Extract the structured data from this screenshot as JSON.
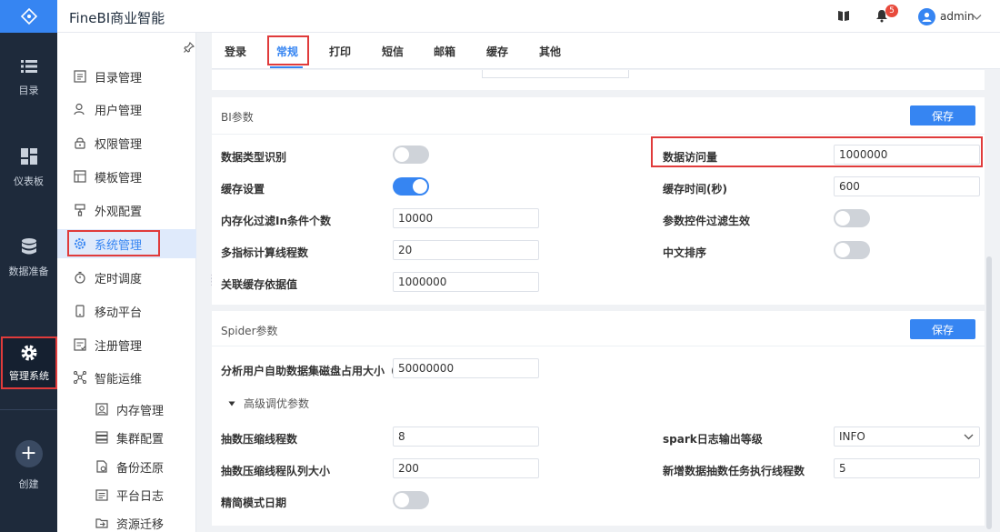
{
  "app": {
    "title": "FineBI商业智能"
  },
  "rail": {
    "items": [
      {
        "label": "目录",
        "icon": "list-icon"
      },
      {
        "label": "仪表板",
        "icon": "dashboard-icon"
      },
      {
        "label": "数据准备",
        "icon": "database-icon"
      },
      {
        "label": "管理系统",
        "icon": "gear-icon",
        "active": true
      },
      {
        "label": "创建",
        "icon": "plus-icon"
      }
    ]
  },
  "header": {
    "notification_count": "5",
    "user": "admin"
  },
  "sidebar": {
    "items": [
      {
        "label": "目录管理"
      },
      {
        "label": "用户管理"
      },
      {
        "label": "权限管理"
      },
      {
        "label": "模板管理"
      },
      {
        "label": "外观配置"
      },
      {
        "label": "系统管理",
        "active": true
      },
      {
        "label": "定时调度"
      },
      {
        "label": "移动平台"
      },
      {
        "label": "注册管理"
      },
      {
        "label": "智能运维"
      },
      {
        "label": "内存管理"
      },
      {
        "label": "集群配置"
      },
      {
        "label": "备份还原"
      },
      {
        "label": "平台日志"
      },
      {
        "label": "资源迁移"
      }
    ]
  },
  "tabs": [
    {
      "label": "登录"
    },
    {
      "label": "常规",
      "active": true
    },
    {
      "label": "打印"
    },
    {
      "label": "短信"
    },
    {
      "label": "邮箱"
    },
    {
      "label": "缓存"
    },
    {
      "label": "其他"
    }
  ],
  "bi_panel": {
    "title": "BI参数",
    "save_label": "保存",
    "left": {
      "data_type": {
        "label": "数据类型识别",
        "on": false
      },
      "cache": {
        "label": "缓存设置",
        "on": true
      },
      "in_filter": {
        "label": "内存化过滤In条件个数",
        "value": "10000"
      },
      "multi_calc": {
        "label": "多指标计算线程数",
        "value": "20"
      },
      "rel_cache": {
        "label": "关联缓存依据值",
        "value": "1000000"
      }
    },
    "right": {
      "visits": {
        "label": "数据访问量",
        "value": "1000000"
      },
      "cache_time": {
        "label": "缓存时间(秒)",
        "value": "600"
      },
      "param_filter": {
        "label": "参数控件过滤生效",
        "on": false
      },
      "cn_sort": {
        "label": "中文排序",
        "on": false
      }
    }
  },
  "spider_panel": {
    "title": "Spider参数",
    "save_label": "保存",
    "disk_usage": {
      "label": "分析用户自助数据集磁盘占用大小（...",
      "value": "50000000"
    },
    "advanced_label": "高级调优参数",
    "compress_threads": {
      "label": "抽数压缩线程数",
      "value": "8"
    },
    "compress_queue": {
      "label": "抽数压缩线程队列大小",
      "value": "200"
    },
    "simple_mode": {
      "label": "精简模式日期",
      "on": false
    },
    "spark_log": {
      "label": "spark日志输出等级",
      "value": "INFO"
    },
    "new_task_threads": {
      "label": "新增数据抽数任务执行线程数",
      "value": "5"
    }
  },
  "colors": {
    "accent": "#3685f2",
    "highlight": "#e03b3b",
    "rail_bg": "#1e2a3b"
  }
}
